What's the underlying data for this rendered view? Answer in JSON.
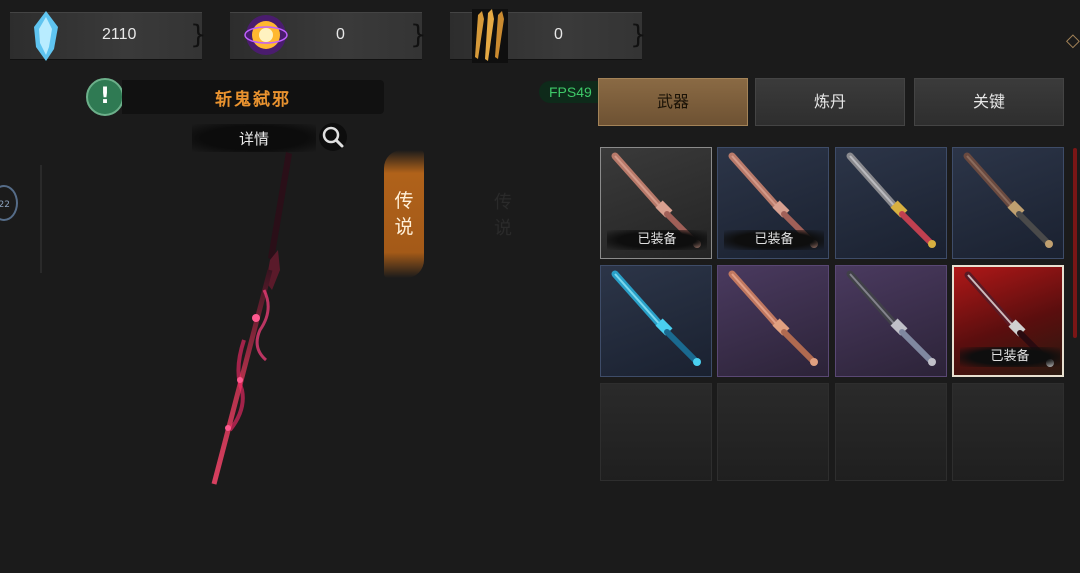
{
  "currency": [
    {
      "icon": "blue-crystal-icon",
      "value": "2110"
    },
    {
      "icon": "golden-orb-icon",
      "value": "0"
    },
    {
      "icon": "triple-blade-icon",
      "value": "0"
    }
  ],
  "weapon": {
    "name": "斩鬼弑邪",
    "details_label": "详情",
    "rarity_label": "传说",
    "ghost_label": "传说"
  },
  "side_badge": "22",
  "fps": "FPS49",
  "tabs": [
    {
      "label": "武器",
      "active": true
    },
    {
      "label": "炼丹",
      "active": false
    },
    {
      "label": "关键",
      "active": false
    }
  ],
  "slots": [
    {
      "rarity": "gray",
      "weapon": "bronze-sword",
      "equipped": "已装备"
    },
    {
      "rarity": "blue",
      "weapon": "bronze-sword",
      "equipped": "已装备"
    },
    {
      "rarity": "blue",
      "weapon": "steel-sword-gold-guard",
      "equipped": ""
    },
    {
      "rarity": "blue",
      "weapon": "dark-ornate-sword",
      "equipped": ""
    },
    {
      "rarity": "blue",
      "weapon": "cyan-crystal-sword",
      "equipped": ""
    },
    {
      "rarity": "purple",
      "weapon": "copper-sword",
      "equipped": ""
    },
    {
      "rarity": "purple",
      "weapon": "dark-steel-sword",
      "equipped": ""
    },
    {
      "rarity": "red",
      "weapon": "demon-spear",
      "equipped": "已装备"
    },
    {
      "rarity": "empty",
      "weapon": "",
      "equipped": ""
    },
    {
      "rarity": "empty",
      "weapon": "",
      "equipped": ""
    },
    {
      "rarity": "empty",
      "weapon": "",
      "equipped": ""
    },
    {
      "rarity": "empty",
      "weapon": "",
      "equipped": ""
    }
  ]
}
